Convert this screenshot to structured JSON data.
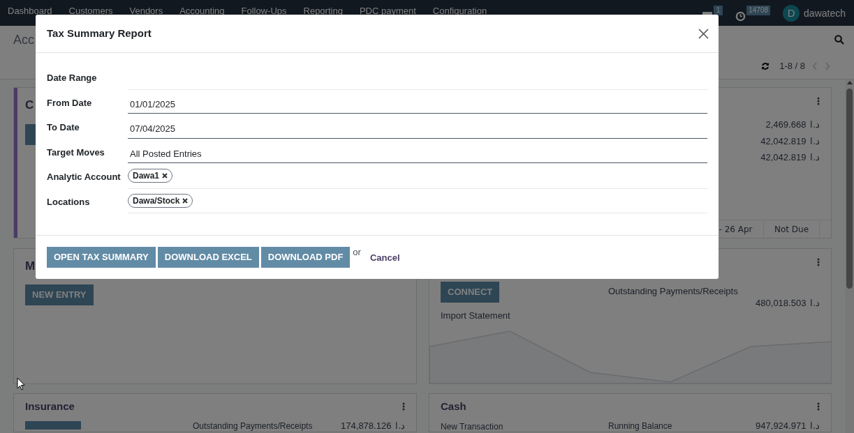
{
  "navbar": {
    "menu": [
      "Dashboard",
      "Customers",
      "Vendors",
      "Accounting",
      "Follow-Ups",
      "Reporting",
      "PDC payment",
      "Configuration"
    ],
    "messages_badge": "1",
    "activities_badge": "14708",
    "user": {
      "initial": "D",
      "name": "dawatech"
    }
  },
  "control_panel": {
    "breadcrumb": "Acc",
    "pager": "1-8 / 8"
  },
  "cards": [
    {
      "kind": "partial",
      "title": "C",
      "color": "#4a3b66"
    },
    {
      "kind": "chart",
      "amounts": [
        {
          "value": "2,469.668",
          "currency": "د.ا"
        },
        {
          "value": "42,042.819",
          "currency": "د.ا"
        },
        {
          "value": "42,042.819",
          "currency": "د.ا"
        }
      ],
      "chart_labels": [
        "- 26 Apr",
        "Not Due"
      ]
    },
    {
      "kind": "partial",
      "title": "M",
      "button": "NEW ENTRY"
    },
    {
      "kind": "bank",
      "button": "CONNECT",
      "link": "Import Statement",
      "stat": {
        "label": "Outstanding Payments/Receipts",
        "value": "480,018.503",
        "currency": "د.ا"
      }
    },
    {
      "kind": "journal",
      "title": "Insurance",
      "stat": {
        "label": "Outstanding Payments/Receipts",
        "value": "174,878.126",
        "currency": "د.ا"
      }
    },
    {
      "kind": "cash",
      "title": "Cash",
      "link": "New Transaction",
      "stat": {
        "label": "Running Balance",
        "value": "947,924.971",
        "currency": "د.ا"
      }
    }
  ],
  "dialog": {
    "title": "Tax Summary Report",
    "fields": [
      {
        "kind": "separator",
        "label": "Date Range"
      },
      {
        "kind": "input",
        "label": "From Date",
        "value": "01/01/2025"
      },
      {
        "kind": "input",
        "label": "To Date",
        "value": "07/04/2025"
      },
      {
        "kind": "input",
        "label": "Target Moves",
        "value": "All Posted Entries"
      },
      {
        "kind": "tags",
        "label": "Analytic Account",
        "tags": [
          "Dawa1"
        ]
      },
      {
        "kind": "tags",
        "label": "Locations",
        "tags": [
          "Dawa/Stock"
        ]
      }
    ],
    "buttons": [
      "OPEN TAX SUMMARY",
      "DOWNLOAD EXCEL",
      "DOWNLOAD PDF"
    ],
    "or": "or",
    "cancel": "Cancel"
  }
}
